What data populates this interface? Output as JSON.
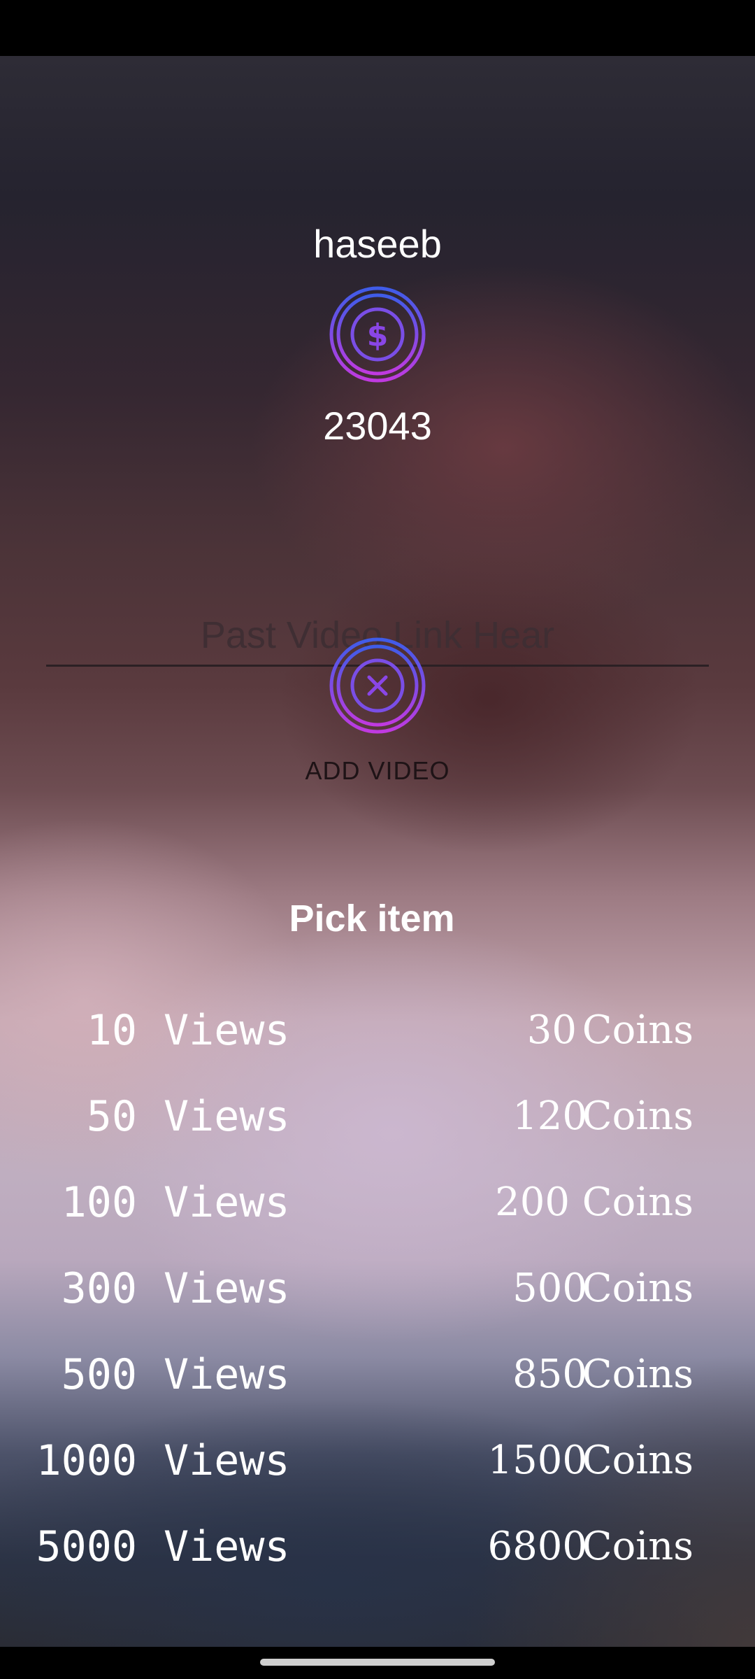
{
  "profile": {
    "username": "haseeb",
    "coin_icon": "dollar-coin-icon",
    "coin_balance": "23043"
  },
  "video_link": {
    "value": "",
    "placeholder": "Past Video Link Hear"
  },
  "add_video": {
    "icon": "close-circle-icon",
    "label": "ADD VIDEO"
  },
  "packages": {
    "title": "Pick item",
    "items": [
      {
        "views": "10",
        "views_label": "Views",
        "price": "30",
        "coins_label": "Coins"
      },
      {
        "views": "50",
        "views_label": "Views",
        "price": "120",
        "coins_label": "Coins"
      },
      {
        "views": "100",
        "views_label": "Views",
        "price": "200",
        "coins_label": "Coins"
      },
      {
        "views": "300",
        "views_label": "Views",
        "price": "500",
        "coins_label": "Coins"
      },
      {
        "views": "500",
        "views_label": "Views",
        "price": "850",
        "coins_label": "Coins"
      },
      {
        "views": "1000",
        "views_label": "Views",
        "price": "1500",
        "coins_label": "Coins"
      },
      {
        "views": "5000",
        "views_label": "Views",
        "price": "6800",
        "coins_label": "Coins"
      }
    ]
  },
  "colors": {
    "icon_gradient_top": "#3f5ce8",
    "icon_gradient_bottom": "#c03ae0",
    "icon_glyph": "#8a46e6"
  }
}
